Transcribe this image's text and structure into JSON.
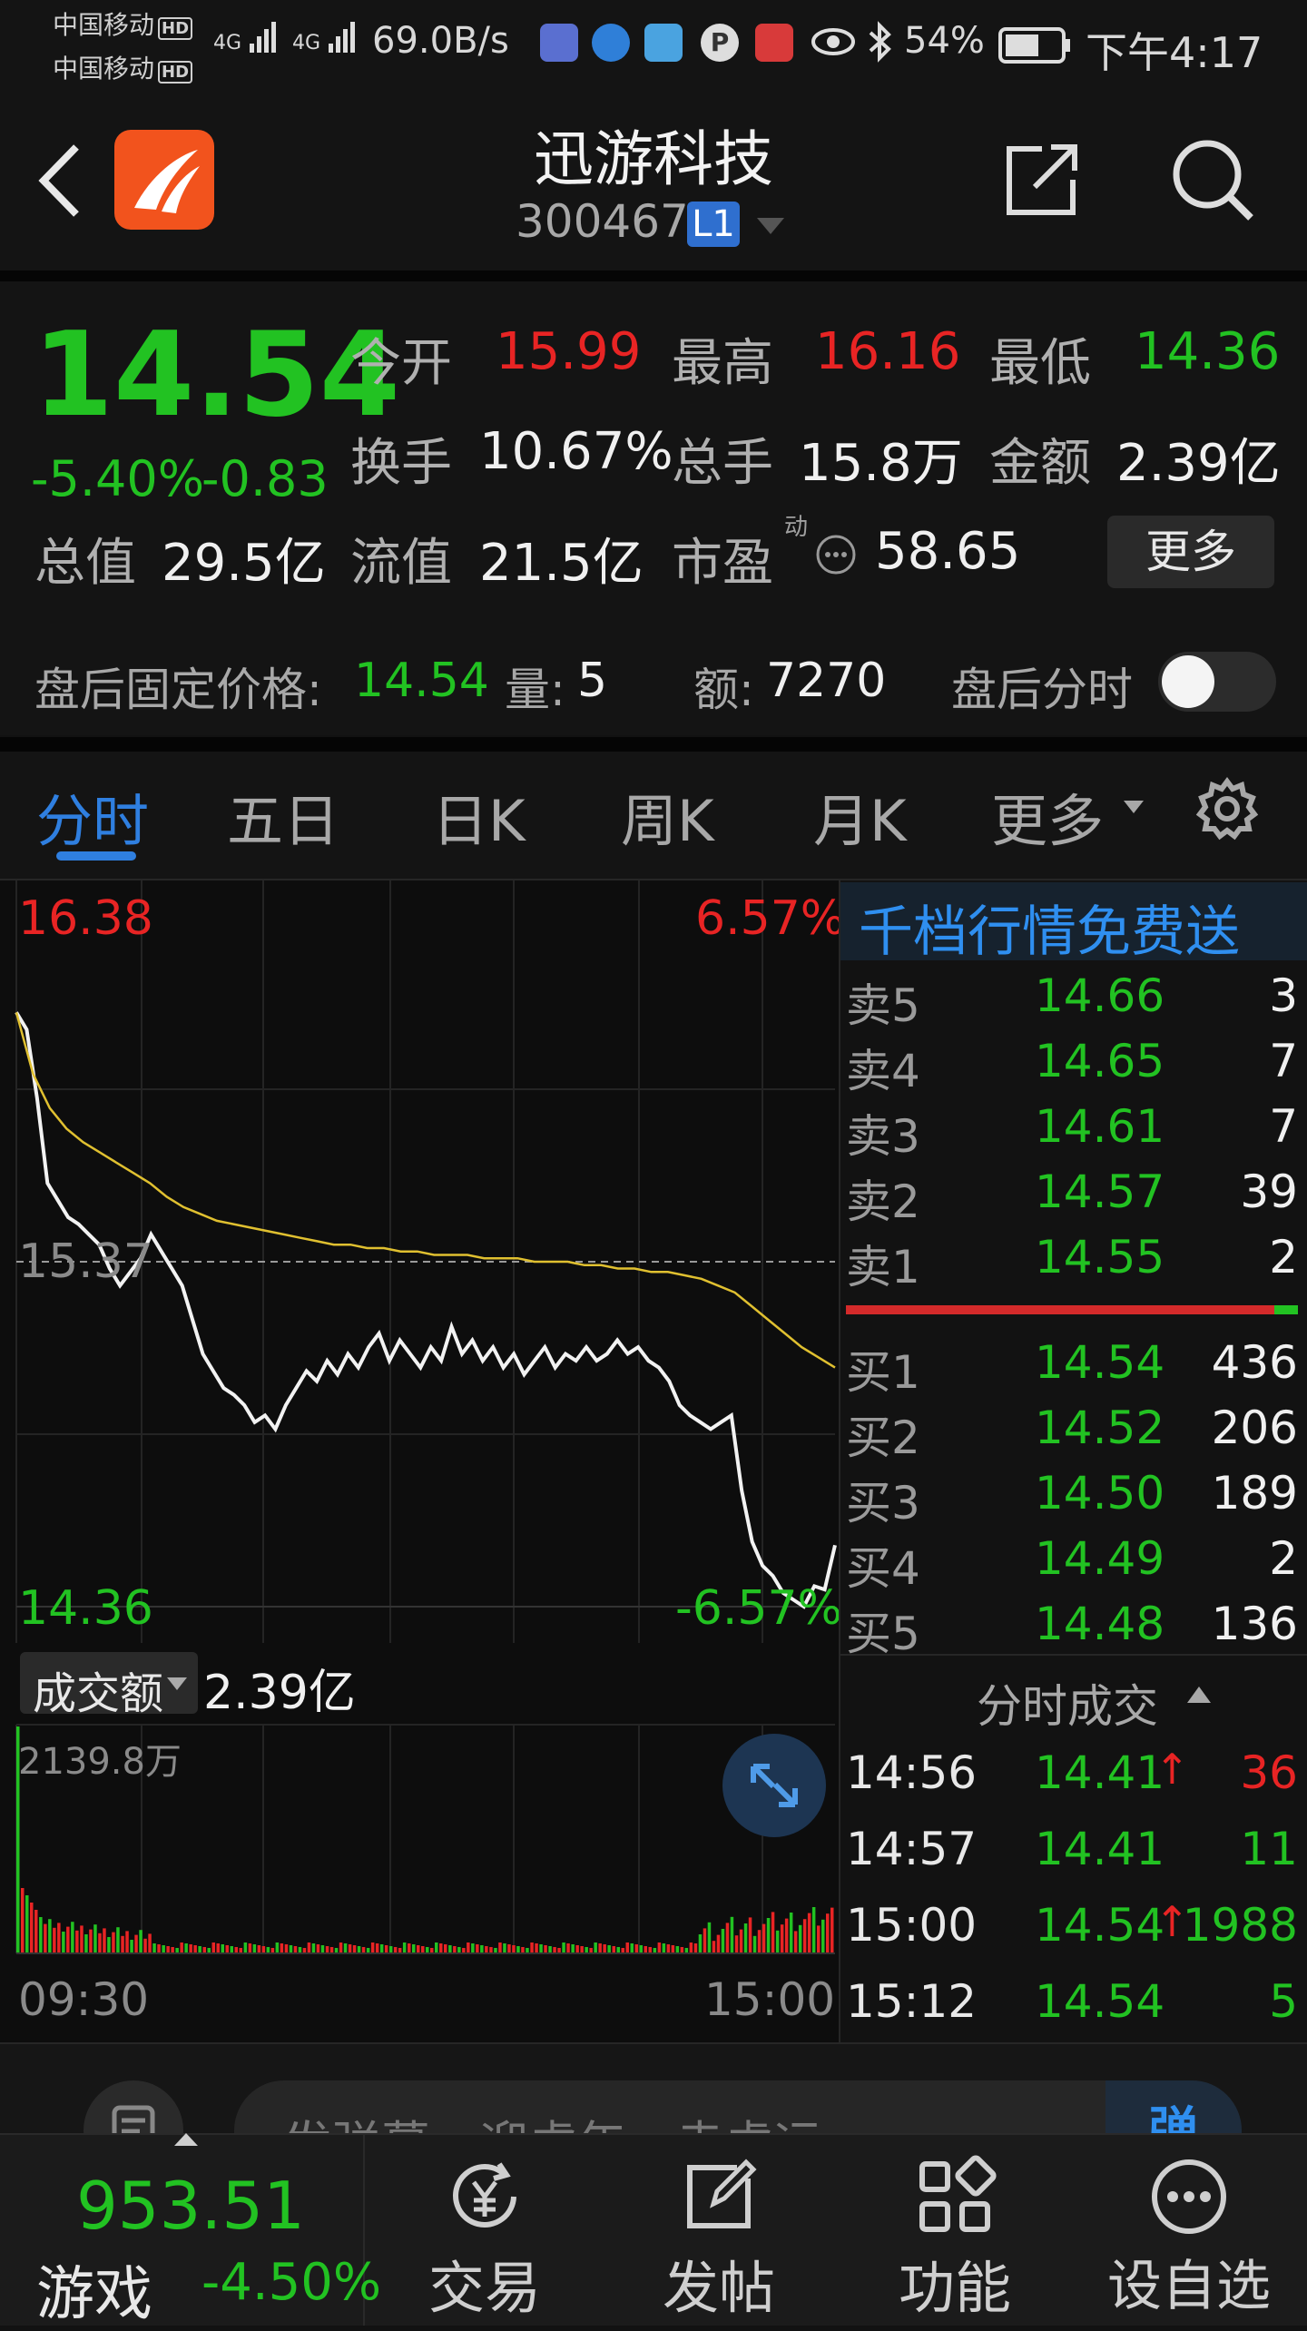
{
  "status_bar": {
    "carrier1": "中国移动",
    "carrier2": "中国移动",
    "hd": "HD",
    "net": "4G",
    "speed": "69.0B/s",
    "battery": "54%",
    "time": "下午4:17"
  },
  "header": {
    "stock_name": "迅游科技",
    "stock_code": "300467",
    "level_badge": "L1"
  },
  "quote": {
    "price": "14.54",
    "change_pct": "-5.40%",
    "change": "-0.83",
    "open_label": "今开",
    "open": "15.99",
    "high_label": "最高",
    "high": "16.16",
    "low_label": "最低",
    "low": "14.36",
    "turnover_label": "换手",
    "turnover": "10.67%",
    "volume_label": "总手",
    "volume": "15.8万",
    "amount_label": "金额",
    "amount": "2.39亿",
    "mktcap_label": "总值",
    "mktcap": "29.5亿",
    "float_label": "流值",
    "float": "21.5亿",
    "pe_label": "市盈",
    "pe_sup": "动",
    "pe": "58.65",
    "more_label": "更多"
  },
  "after_hours": {
    "price_label": "盘后固定价格:",
    "price": "14.54",
    "vol_label": "量:",
    "vol": "5",
    "amt_label": "额:",
    "amt": "7270",
    "toggle_label": "盘后分时",
    "toggle_on": false
  },
  "tabs": [
    {
      "label": "分时",
      "active": true
    },
    {
      "label": "五日",
      "active": false
    },
    {
      "label": "日K",
      "active": false
    },
    {
      "label": "周K",
      "active": false
    },
    {
      "label": "月K",
      "active": false
    },
    {
      "label": "更多",
      "active": false
    }
  ],
  "chart_data": {
    "type": "line",
    "y_max_label": "16.38",
    "y_min_label": "14.36",
    "y_mid_label": "15.37",
    "pct_max_label": "6.57%",
    "pct_min_label": "-6.57%",
    "ylim": [
      14.36,
      16.38
    ],
    "x_start": "09:30",
    "x_end": "15:00",
    "series": [
      {
        "values": [
          16.1,
          16.05,
          15.85,
          15.6,
          15.55,
          15.5,
          15.48,
          15.45,
          15.42,
          15.35,
          15.3,
          15.34,
          15.38,
          15.45,
          15.4,
          15.35,
          15.3,
          15.2,
          15.1,
          15.05,
          15.0,
          14.98,
          14.95,
          14.9,
          14.92,
          14.88,
          14.95,
          15.0,
          15.05,
          15.02,
          15.08,
          15.04,
          15.1,
          15.06,
          15.12,
          15.16,
          15.08,
          15.14,
          15.1,
          15.06,
          15.12,
          15.08,
          15.18,
          15.1,
          15.14,
          15.08,
          15.12,
          15.06,
          15.1,
          15.04,
          15.08,
          15.12,
          15.06,
          15.1,
          15.08,
          15.12,
          15.08,
          15.1,
          15.14,
          15.1,
          15.12,
          15.08,
          15.06,
          15.02,
          14.95,
          14.92,
          14.9,
          14.88,
          14.9,
          14.92,
          14.7,
          14.55,
          14.48,
          14.45,
          14.4,
          14.38,
          14.36,
          14.42,
          14.41,
          14.54
        ]
      },
      {
        "values": [
          16.1,
          15.92,
          15.82,
          15.76,
          15.72,
          15.69,
          15.66,
          15.63,
          15.6,
          15.56,
          15.53,
          15.51,
          15.49,
          15.48,
          15.47,
          15.46,
          15.45,
          15.44,
          15.43,
          15.42,
          15.42,
          15.41,
          15.41,
          15.4,
          15.4,
          15.39,
          15.39,
          15.39,
          15.38,
          15.38,
          15.38,
          15.37,
          15.37,
          15.37,
          15.36,
          15.36,
          15.35,
          15.35,
          15.34,
          15.34,
          15.33,
          15.32,
          15.3,
          15.28,
          15.24,
          15.2,
          15.16,
          15.12,
          15.09,
          15.06
        ]
      }
    ]
  },
  "volume_chart": {
    "selector_label": "成交额",
    "total": "2.39亿",
    "max_label": "2139.8万",
    "x_start": "09:30",
    "x_end": "15:00"
  },
  "order_book": {
    "promo": "千档行情免费送",
    "asks": [
      {
        "label": "卖5",
        "price": "14.66",
        "vol": "3"
      },
      {
        "label": "卖4",
        "price": "14.65",
        "vol": "7"
      },
      {
        "label": "卖3",
        "price": "14.61",
        "vol": "7"
      },
      {
        "label": "卖2",
        "price": "14.57",
        "vol": "39"
      },
      {
        "label": "卖1",
        "price": "14.55",
        "vol": "2"
      }
    ],
    "bids": [
      {
        "label": "买1",
        "price": "14.54",
        "vol": "436"
      },
      {
        "label": "买2",
        "price": "14.52",
        "vol": "206"
      },
      {
        "label": "买3",
        "price": "14.50",
        "vol": "189"
      },
      {
        "label": "买4",
        "price": "14.49",
        "vol": "2"
      },
      {
        "label": "买5",
        "price": "14.48",
        "vol": "136"
      }
    ]
  },
  "ticks": {
    "title": "分时成交",
    "rows": [
      {
        "time": "14:56",
        "price": "14.41",
        "arrow": "↑",
        "vol": "36",
        "vol_color": "#e82424"
      },
      {
        "time": "14:57",
        "price": "14.41",
        "arrow": "",
        "vol": "11",
        "vol_color": "#22c222"
      },
      {
        "time": "15:00",
        "price": "14.54",
        "arrow": "↑",
        "vol": "1988",
        "vol_color": "#22c222"
      },
      {
        "time": "15:12",
        "price": "14.54",
        "arrow": "",
        "vol": "5",
        "vol_color": "#22c222"
      }
    ]
  },
  "comment_bar": {
    "placeholder": "发弹幕，迎虎年，走虎运",
    "danmu_label": "弹"
  },
  "bottom_nav": {
    "index_value": "953.51",
    "index_name": "游戏",
    "index_change": "-4.50%",
    "items": [
      {
        "label": "交易",
        "icon": "trade-yen-icon"
      },
      {
        "label": "发帖",
        "icon": "edit-post-icon"
      },
      {
        "label": "功能",
        "icon": "grid-icon"
      },
      {
        "label": "设自选",
        "icon": "more-dots-icon"
      }
    ]
  }
}
